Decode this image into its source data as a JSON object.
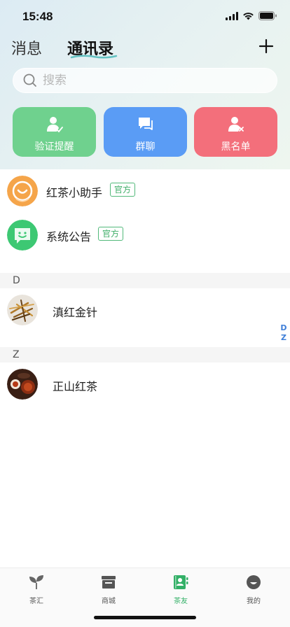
{
  "status": {
    "time": "15:48"
  },
  "header": {
    "tab_messages": "消息",
    "tab_contacts": "通讯录"
  },
  "search": {
    "placeholder": "搜索"
  },
  "quick_actions": [
    {
      "label": "验证提醒",
      "icon": "user-check-icon",
      "color": "#6fd18e"
    },
    {
      "label": "群聊",
      "icon": "chat-bubbles-icon",
      "color": "#5a9cf5"
    },
    {
      "label": "黑名单",
      "icon": "user-block-icon",
      "color": "#f36f7b"
    }
  ],
  "official_accounts": [
    {
      "name": "红茶小助手",
      "badge": "官方",
      "icon": "assistant-icon"
    },
    {
      "name": "系统公告",
      "badge": "官方",
      "icon": "announcement-icon"
    }
  ],
  "sections": [
    {
      "letter": "D",
      "contacts": [
        {
          "name": "滇红金针"
        }
      ]
    },
    {
      "letter": "Z",
      "contacts": [
        {
          "name": "正山红茶"
        }
      ]
    }
  ],
  "index_letters": [
    "D",
    "Z"
  ],
  "tabbar": {
    "items": [
      {
        "label": "茶汇",
        "icon": "leaf-icon",
        "active": false
      },
      {
        "label": "商城",
        "icon": "store-icon",
        "active": false
      },
      {
        "label": "茶友",
        "icon": "contacts-book-icon",
        "active": true
      },
      {
        "label": "我的",
        "icon": "profile-icon",
        "active": false
      }
    ]
  },
  "colors": {
    "accent": "#33b067",
    "index": "#3f7fd8"
  }
}
